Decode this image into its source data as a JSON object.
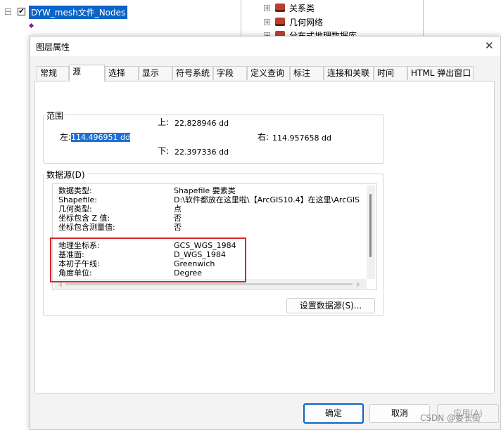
{
  "toc": {
    "layer_name": "DYW_mesh文件_Nodes",
    "expander_minus": "−",
    "checkbox_mark": "✔"
  },
  "catalog": {
    "items": [
      {
        "label": "关系类"
      },
      {
        "label": "几何网络"
      },
      {
        "label": "分布式地理数据库"
      }
    ],
    "expander_plus": "+"
  },
  "dialog": {
    "title": "图层属性",
    "close_glyph": "✕",
    "tabs": [
      "常规",
      "源",
      "选择",
      "显示",
      "符号系统",
      "字段",
      "定义查询",
      "标注",
      "连接和关联",
      "时间",
      "HTML 弹出窗口"
    ],
    "active_tab": "源",
    "extent": {
      "label": "范围",
      "top_label": "上:",
      "top_value": "22.828946 dd",
      "left_label": "左:",
      "left_value": "114.496951 dd",
      "right_label": "右:",
      "right_value": "114.957658 dd",
      "bottom_label": "下:",
      "bottom_value": "22.397336 dd"
    },
    "datasource": {
      "label": "数据源(D)",
      "rows": [
        {
          "key": "数据类型:",
          "value": "Shapefile 要素类"
        },
        {
          "key": "Shapefile:",
          "value": "D:\\软件都放在这里啦\\【ArcGIS10.4】在这里\\ArcGIS"
        },
        {
          "key": "几何类型:",
          "value": "点"
        },
        {
          "key": "坐标包含 Z 值:",
          "value": "否"
        },
        {
          "key": "坐标包含测量值:",
          "value": "否"
        }
      ],
      "gcs_rows": [
        {
          "key": "地理坐标系:",
          "value": "GCS_WGS_1984"
        },
        {
          "key": "基准面:",
          "value": "D_WGS_1984"
        },
        {
          "key": "本初子午线:",
          "value": "Greenwich"
        },
        {
          "key": "角度单位:",
          "value": "Degree"
        }
      ],
      "highlight_color": "#d9262c",
      "set_source_button": "设置数据源(S)..."
    },
    "buttons": {
      "ok": "确定",
      "cancel": "取消",
      "apply": "应用(A)"
    }
  },
  "watermark": "CSDN @娄长街"
}
